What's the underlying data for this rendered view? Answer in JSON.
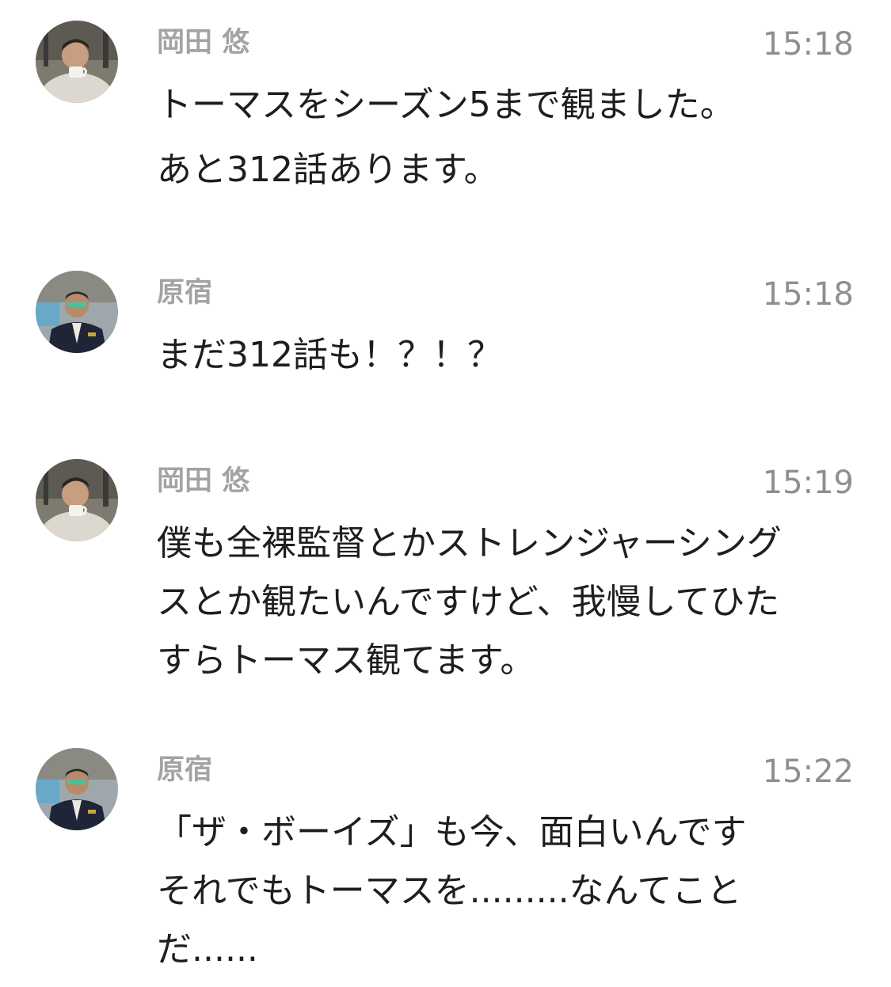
{
  "messages": [
    {
      "sender": "岡田 悠",
      "time": "15:18",
      "avatar_icon": "person-with-cup-avatar",
      "lines": [
        "トーマスをシーズン5まで観ました。",
        "あと312話あります。"
      ]
    },
    {
      "sender": "原宿",
      "time": "15:18",
      "avatar_icon": "person-in-uniform-avatar",
      "lines": [
        "まだ312話も！？！？"
      ]
    },
    {
      "sender": "岡田 悠",
      "time": "15:19",
      "avatar_icon": "person-with-cup-avatar",
      "lines": [
        "僕も全裸監督とかストレンジャーシング",
        "スとか観たいんですけど、我慢してひた",
        "すらトーマス観てます。"
      ]
    },
    {
      "sender": "原宿",
      "time": "15:22",
      "avatar_icon": "person-in-uniform-avatar",
      "lines": [
        "「ザ・ボーイズ」も今、面白いんです",
        "それでもトーマスを.........なんてこと",
        "だ......"
      ]
    }
  ],
  "colors": {
    "sender_name": "#a3a3a3",
    "timestamp": "#8f8f8f",
    "message_text": "#1e1e1e",
    "background": "#ffffff"
  }
}
